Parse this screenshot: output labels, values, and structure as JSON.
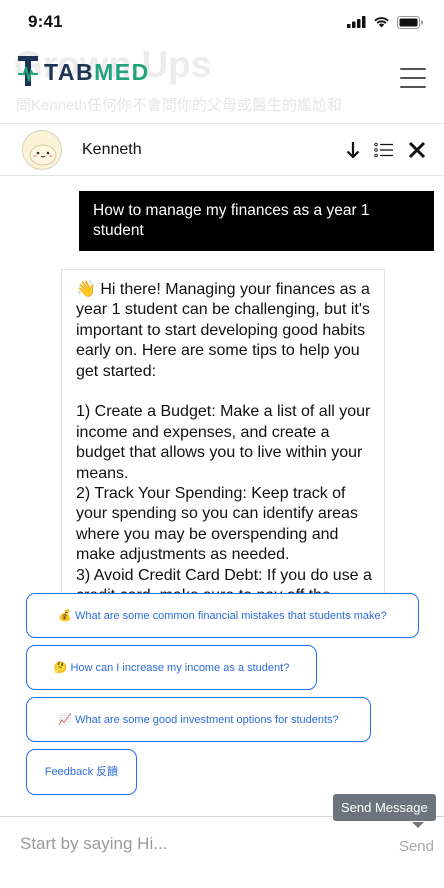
{
  "status_bar": {
    "time": "9:41"
  },
  "header": {
    "logo_text_primary": "TAB",
    "logo_text_accent": "MED",
    "background_title": "Grown Ups",
    "background_subtitle": "問Kenneth任何你不會問你的父母或醫生的尷尬和",
    "logo_color": "#1c3555",
    "accent_color": "#22a37b"
  },
  "chat_header": {
    "name": "Kenneth",
    "actions": [
      "arrow-down-icon",
      "list-icon",
      "close-icon"
    ]
  },
  "messages": {
    "user_message": "How to manage my finances as a year 1 student",
    "bot_message": "👋 Hi there! Managing your finances as a year 1 student can be challenging, but it's important to start developing good habits early on. Here are some tips to help you get started:\n\n1) Create a Budget: Make a list of all your income and expenses, and create a budget that allows you to live within your means.\n2) Track Your Spending: Keep track of your spending so you can identify areas where you may be overspending and make adjustments as needed.\n3) Avoid Credit Card Debt: If you do use a credit card, make sure to pay off the balance in full each month to avoid"
  },
  "suggestions": [
    {
      "emoji": "💰",
      "label": "What are some common financial mistakes that students make?"
    },
    {
      "emoji": "🤔",
      "label": "How can I increase my income as a student?"
    },
    {
      "emoji": "📈",
      "label": "What are some good investment options for students?"
    },
    {
      "emoji": "",
      "label": "Feedback 反饋"
    }
  ],
  "composer": {
    "placeholder": "Start by saying Hi...",
    "send_label": "Send",
    "tooltip": "Send Message"
  },
  "colors": {
    "suggestion_border": "#1e6ff2",
    "suggestion_text": "#2d6dd6",
    "user_bubble": "#000000",
    "tooltip_bg": "#6c757d"
  }
}
